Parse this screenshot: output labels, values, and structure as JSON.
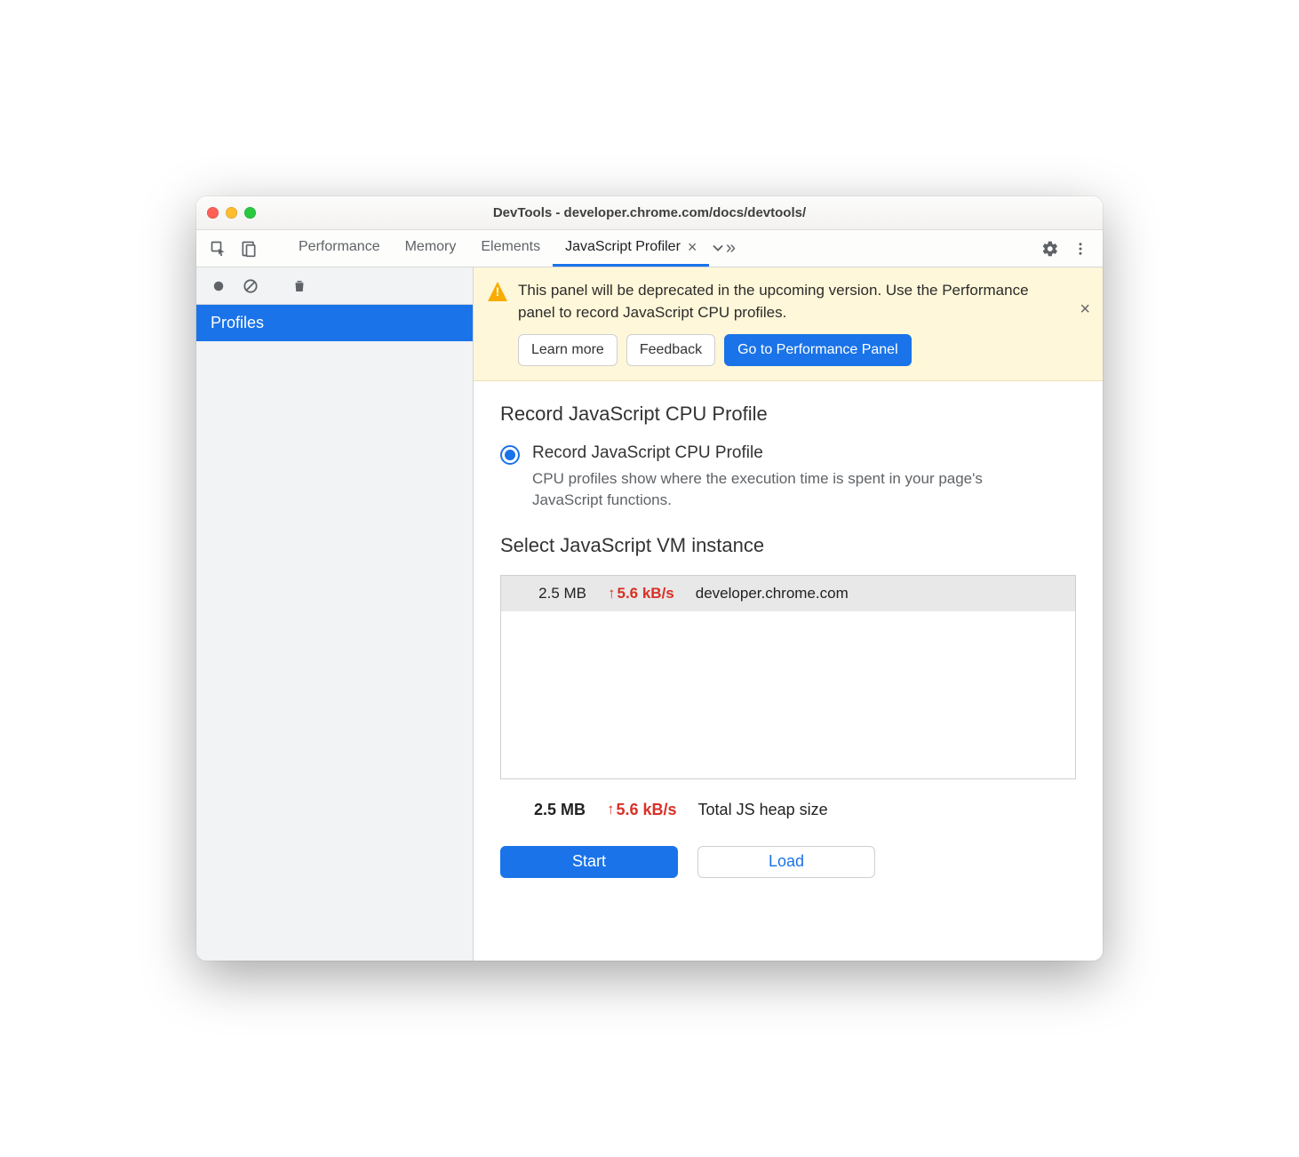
{
  "window_title": "DevTools - developer.chrome.com/docs/devtools/",
  "tabs": {
    "items": [
      "Performance",
      "Memory",
      "Elements",
      "JavaScript Profiler"
    ],
    "active_index": 3
  },
  "sidebar": {
    "profiles_label": "Profiles"
  },
  "banner": {
    "text": "This panel will be deprecated in the upcoming version. Use the Performance panel to record JavaScript CPU profiles.",
    "learn_more": "Learn more",
    "feedback": "Feedback",
    "go_perf": "Go to Performance Panel"
  },
  "profile": {
    "heading": "Record JavaScript CPU Profile",
    "radio_label": "Record JavaScript CPU Profile",
    "radio_desc": "CPU profiles show where the execution time is spent in your page's JavaScript functions."
  },
  "vm": {
    "heading": "Select JavaScript VM instance",
    "size": "2.5 MB",
    "rate": "5.6 kB/s",
    "host": "developer.chrome.com",
    "total_size": "2.5 MB",
    "total_rate": "5.6 kB/s",
    "total_label": "Total JS heap size"
  },
  "actions": {
    "start": "Start",
    "load": "Load"
  }
}
